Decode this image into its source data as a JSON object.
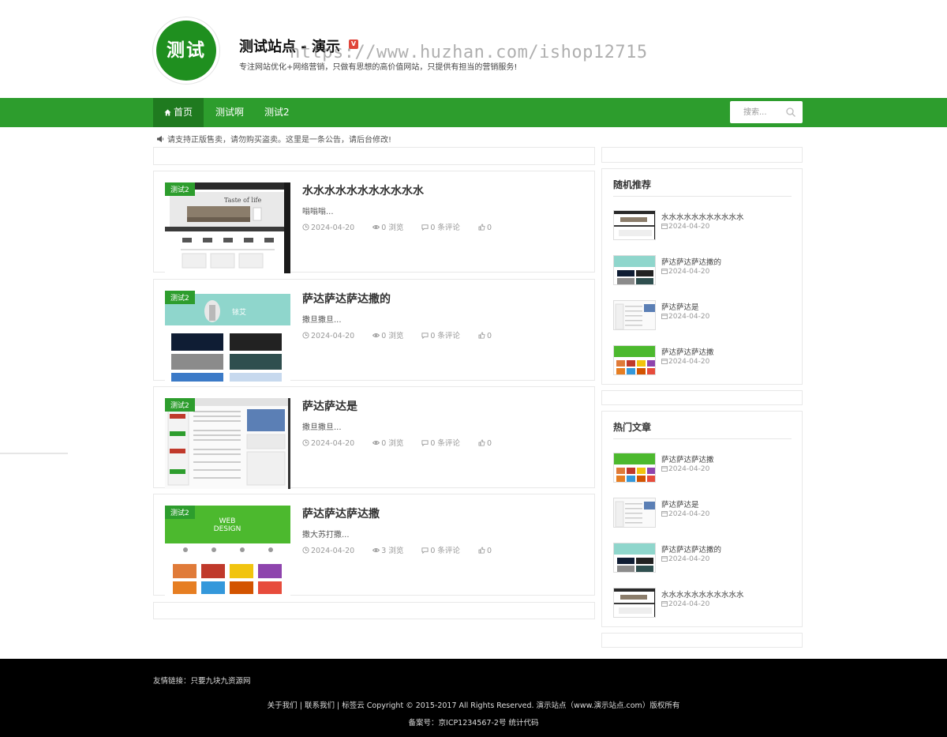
{
  "header": {
    "logo_text": "测试",
    "site_title": "测试站点 - 演示",
    "badge": "V",
    "description": "专注网站优化+网络营销，只做有思想的高价值网站，只提供有担当的营销服务!",
    "watermark": "https://www.huzhan.com/ishop12715"
  },
  "nav": {
    "items": [
      "首页",
      "测试啊",
      "测试2"
    ],
    "search_placeholder": "搜索..."
  },
  "notice": "请支持正版售卖，请勿购买盗卖。这里是一条公告，请后台修改!",
  "posts": [
    {
      "tag": "测试2",
      "title": "水水水水水水水水水水水",
      "excerpt": "嗡嗡嗡...",
      "date": "2024-04-20",
      "views": "0 浏览",
      "comments": "0 条评论",
      "likes": "0"
    },
    {
      "tag": "测试2",
      "title": "萨达萨达萨达撒的",
      "excerpt": "撒旦撒旦...",
      "date": "2024-04-20",
      "views": "0 浏览",
      "comments": "0 条评论",
      "likes": "0"
    },
    {
      "tag": "测试2",
      "title": "萨达萨达是",
      "excerpt": "撒旦撒旦...",
      "date": "2024-04-20",
      "views": "0 浏览",
      "comments": "0 条评论",
      "likes": "0"
    },
    {
      "tag": "测试2",
      "title": "萨达萨达萨达撒",
      "excerpt": "撒大苏打撒...",
      "date": "2024-04-20",
      "views": "3 浏览",
      "comments": "0 条评论",
      "likes": "0"
    }
  ],
  "sidebar": {
    "random": {
      "title": "随机推荐",
      "items": [
        {
          "title": "水水水水水水水水水水水",
          "date": "2024-04-20"
        },
        {
          "title": "萨达萨达萨达撒的",
          "date": "2024-04-20"
        },
        {
          "title": "萨达萨达是",
          "date": "2024-04-20"
        },
        {
          "title": "萨达萨达萨达撒",
          "date": "2024-04-20"
        }
      ]
    },
    "hot": {
      "title": "热门文章",
      "items": [
        {
          "title": "萨达萨达萨达撒",
          "date": "2024-04-20"
        },
        {
          "title": "萨达萨达是",
          "date": "2024-04-20"
        },
        {
          "title": "萨达萨达萨达撒的",
          "date": "2024-04-20"
        },
        {
          "title": "水水水水水水水水水水水",
          "date": "2024-04-20"
        }
      ]
    }
  },
  "footer": {
    "friend_links_label": "友情链接：",
    "friend_link": "只要九块九资源网",
    "copyright_links": [
      "关于我们",
      "联系我们",
      "标签云"
    ],
    "copyright_text": "Copyright © 2015-2017 All Rights Reserved. 演示站点（www.演示站点.com）版权所有",
    "icp": "备案号：京ICP1234567-2号 统计代码"
  },
  "colors": {
    "brand_green": "#2d9d2d",
    "nav_active": "#1f7a1f",
    "logo_green": "#1f8f1f",
    "footer_bg": "#000000"
  }
}
